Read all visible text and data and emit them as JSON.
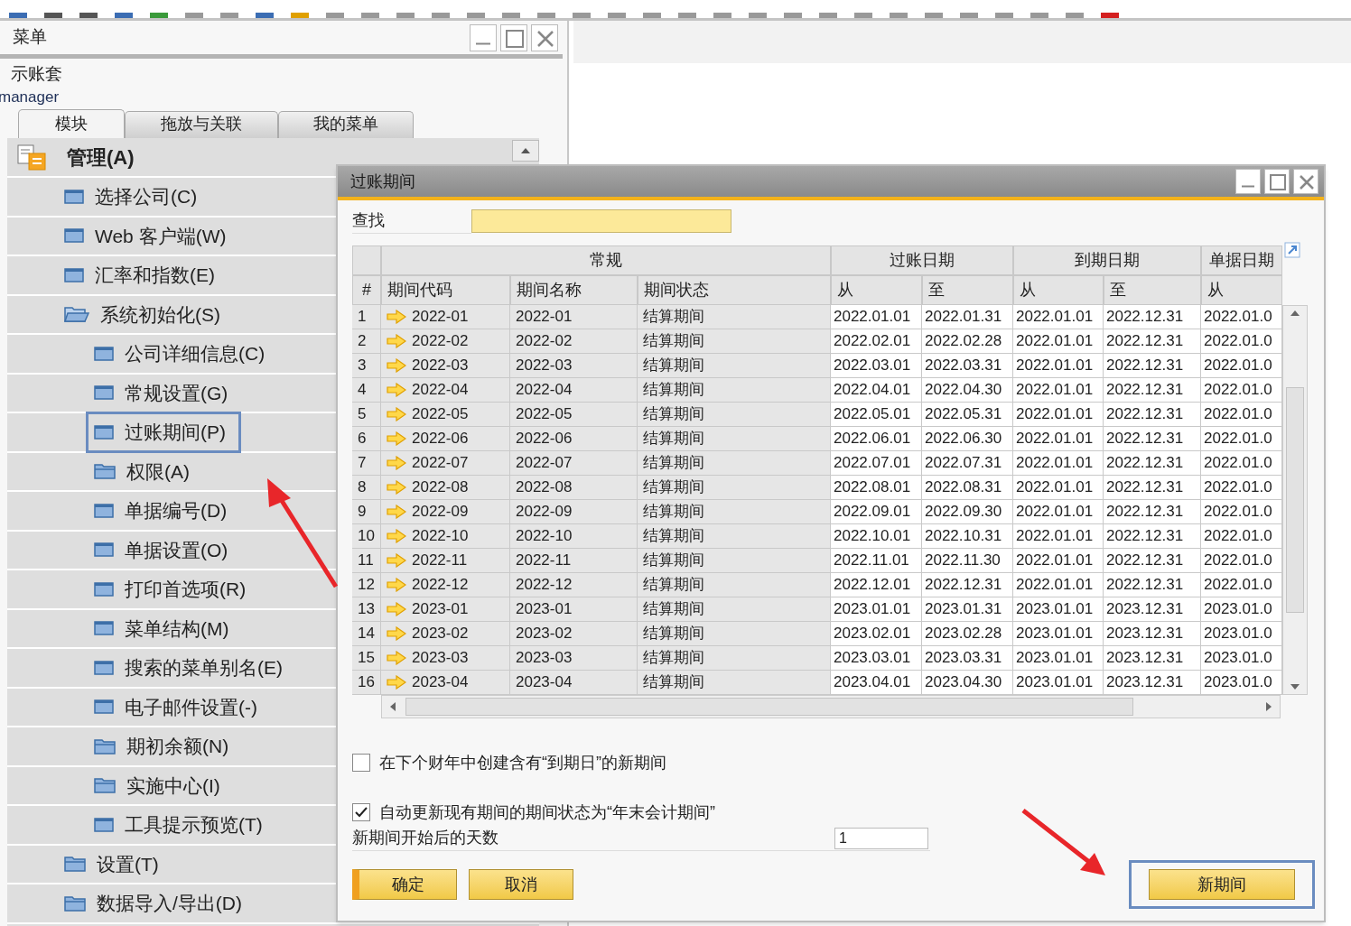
{
  "main_menu": {
    "title": "菜单",
    "company": "示账套",
    "user": "manager",
    "tabs": [
      {
        "label": "模块",
        "selected": true
      },
      {
        "label": "拖放与关联",
        "selected": false
      },
      {
        "label": "我的菜单",
        "selected": false
      }
    ],
    "module": {
      "label": "管理(A)",
      "items": [
        {
          "label": "选择公司(C)",
          "kind": "window",
          "selected": false
        },
        {
          "label": "Web 客户端(W)",
          "kind": "window",
          "selected": false
        },
        {
          "label": "汇率和指数(E)",
          "kind": "window",
          "selected": false
        },
        {
          "label": "系统初始化(S)",
          "kind": "folder",
          "expanded": true,
          "selected": false,
          "children": [
            {
              "label": "公司详细信息(C)",
              "kind": "window",
              "selected": false
            },
            {
              "label": "常规设置(G)",
              "kind": "window",
              "selected": false
            },
            {
              "label": "过账期间(P)",
              "kind": "window",
              "selected": true
            },
            {
              "label": "权限(A)",
              "kind": "folder",
              "expanded": false,
              "selected": false
            },
            {
              "label": "单据编号(D)",
              "kind": "window",
              "selected": false
            },
            {
              "label": "单据设置(O)",
              "kind": "window",
              "selected": false
            },
            {
              "label": "打印首选项(R)",
              "kind": "window",
              "selected": false
            },
            {
              "label": "菜单结构(M)",
              "kind": "window",
              "selected": false
            },
            {
              "label": "搜索的菜单别名(E)",
              "kind": "window",
              "selected": false
            },
            {
              "label": "电子邮件设置(-)",
              "kind": "window",
              "selected": false
            },
            {
              "label": "期初余额(N)",
              "kind": "folder",
              "expanded": false,
              "selected": false
            },
            {
              "label": "实施中心(I)",
              "kind": "folder",
              "expanded": false,
              "selected": false
            },
            {
              "label": "工具提示预览(T)",
              "kind": "window",
              "selected": false
            }
          ]
        },
        {
          "label": "设置(T)",
          "kind": "folder",
          "expanded": false,
          "selected": false
        },
        {
          "label": "数据导入/导出(D)",
          "kind": "folder",
          "expanded": false,
          "selected": false
        }
      ]
    }
  },
  "dialog": {
    "title": "过账期间",
    "find": {
      "label": "查找"
    },
    "table": {
      "index_header": "#",
      "column_groups": [
        {
          "label": "常规",
          "columns": [
            "期间代码",
            "期间名称",
            "期间状态"
          ]
        },
        {
          "label": "过账日期",
          "columns": [
            "从",
            "至"
          ]
        },
        {
          "label": "到期日期",
          "columns": [
            "从",
            "至"
          ]
        },
        {
          "label": "单据日期",
          "columns": [
            "从"
          ]
        }
      ],
      "rows": [
        [
          "1",
          "2022-01",
          "2022-01",
          "结算期间",
          "2022.01.01",
          "2022.01.31",
          "2022.01.01",
          "2022.12.31",
          "2022.01.0"
        ],
        [
          "2",
          "2022-02",
          "2022-02",
          "结算期间",
          "2022.02.01",
          "2022.02.28",
          "2022.01.01",
          "2022.12.31",
          "2022.01.0"
        ],
        [
          "3",
          "2022-03",
          "2022-03",
          "结算期间",
          "2022.03.01",
          "2022.03.31",
          "2022.01.01",
          "2022.12.31",
          "2022.01.0"
        ],
        [
          "4",
          "2022-04",
          "2022-04",
          "结算期间",
          "2022.04.01",
          "2022.04.30",
          "2022.01.01",
          "2022.12.31",
          "2022.01.0"
        ],
        [
          "5",
          "2022-05",
          "2022-05",
          "结算期间",
          "2022.05.01",
          "2022.05.31",
          "2022.01.01",
          "2022.12.31",
          "2022.01.0"
        ],
        [
          "6",
          "2022-06",
          "2022-06",
          "结算期间",
          "2022.06.01",
          "2022.06.30",
          "2022.01.01",
          "2022.12.31",
          "2022.01.0"
        ],
        [
          "7",
          "2022-07",
          "2022-07",
          "结算期间",
          "2022.07.01",
          "2022.07.31",
          "2022.01.01",
          "2022.12.31",
          "2022.01.0"
        ],
        [
          "8",
          "2022-08",
          "2022-08",
          "结算期间",
          "2022.08.01",
          "2022.08.31",
          "2022.01.01",
          "2022.12.31",
          "2022.01.0"
        ],
        [
          "9",
          "2022-09",
          "2022-09",
          "结算期间",
          "2022.09.01",
          "2022.09.30",
          "2022.01.01",
          "2022.12.31",
          "2022.01.0"
        ],
        [
          "10",
          "2022-10",
          "2022-10",
          "结算期间",
          "2022.10.01",
          "2022.10.31",
          "2022.01.01",
          "2022.12.31",
          "2022.01.0"
        ],
        [
          "11",
          "2022-11",
          "2022-11",
          "结算期间",
          "2022.11.01",
          "2022.11.30",
          "2022.01.01",
          "2022.12.31",
          "2022.01.0"
        ],
        [
          "12",
          "2022-12",
          "2022-12",
          "结算期间",
          "2022.12.01",
          "2022.12.31",
          "2022.01.01",
          "2022.12.31",
          "2022.01.0"
        ],
        [
          "13",
          "2023-01",
          "2023-01",
          "结算期间",
          "2023.01.01",
          "2023.01.31",
          "2023.01.01",
          "2023.12.31",
          "2023.01.0"
        ],
        [
          "14",
          "2023-02",
          "2023-02",
          "结算期间",
          "2023.02.01",
          "2023.02.28",
          "2023.01.01",
          "2023.12.31",
          "2023.01.0"
        ],
        [
          "15",
          "2023-03",
          "2023-03",
          "结算期间",
          "2023.03.01",
          "2023.03.31",
          "2023.01.01",
          "2023.12.31",
          "2023.01.0"
        ],
        [
          "16",
          "2023-04",
          "2023-04",
          "结算期间",
          "2023.04.01",
          "2023.04.30",
          "2023.01.01",
          "2023.12.31",
          "2023.01.0"
        ]
      ]
    },
    "options": [
      {
        "label": "在下个财年中创建含有“到期日”的新期间",
        "checked": false
      },
      {
        "label": "自动更新现有期间的期间状态为“年末会计期间”",
        "checked": true
      }
    ],
    "days_field": {
      "label": "新期间开始后的天数",
      "value": "1"
    },
    "buttons": [
      {
        "label": "确定",
        "kind": "ok",
        "highlighted": false
      },
      {
        "label": "取消",
        "kind": "cancel",
        "highlighted": false
      },
      {
        "label": "新期间",
        "kind": "new",
        "highlighted": true
      }
    ]
  }
}
